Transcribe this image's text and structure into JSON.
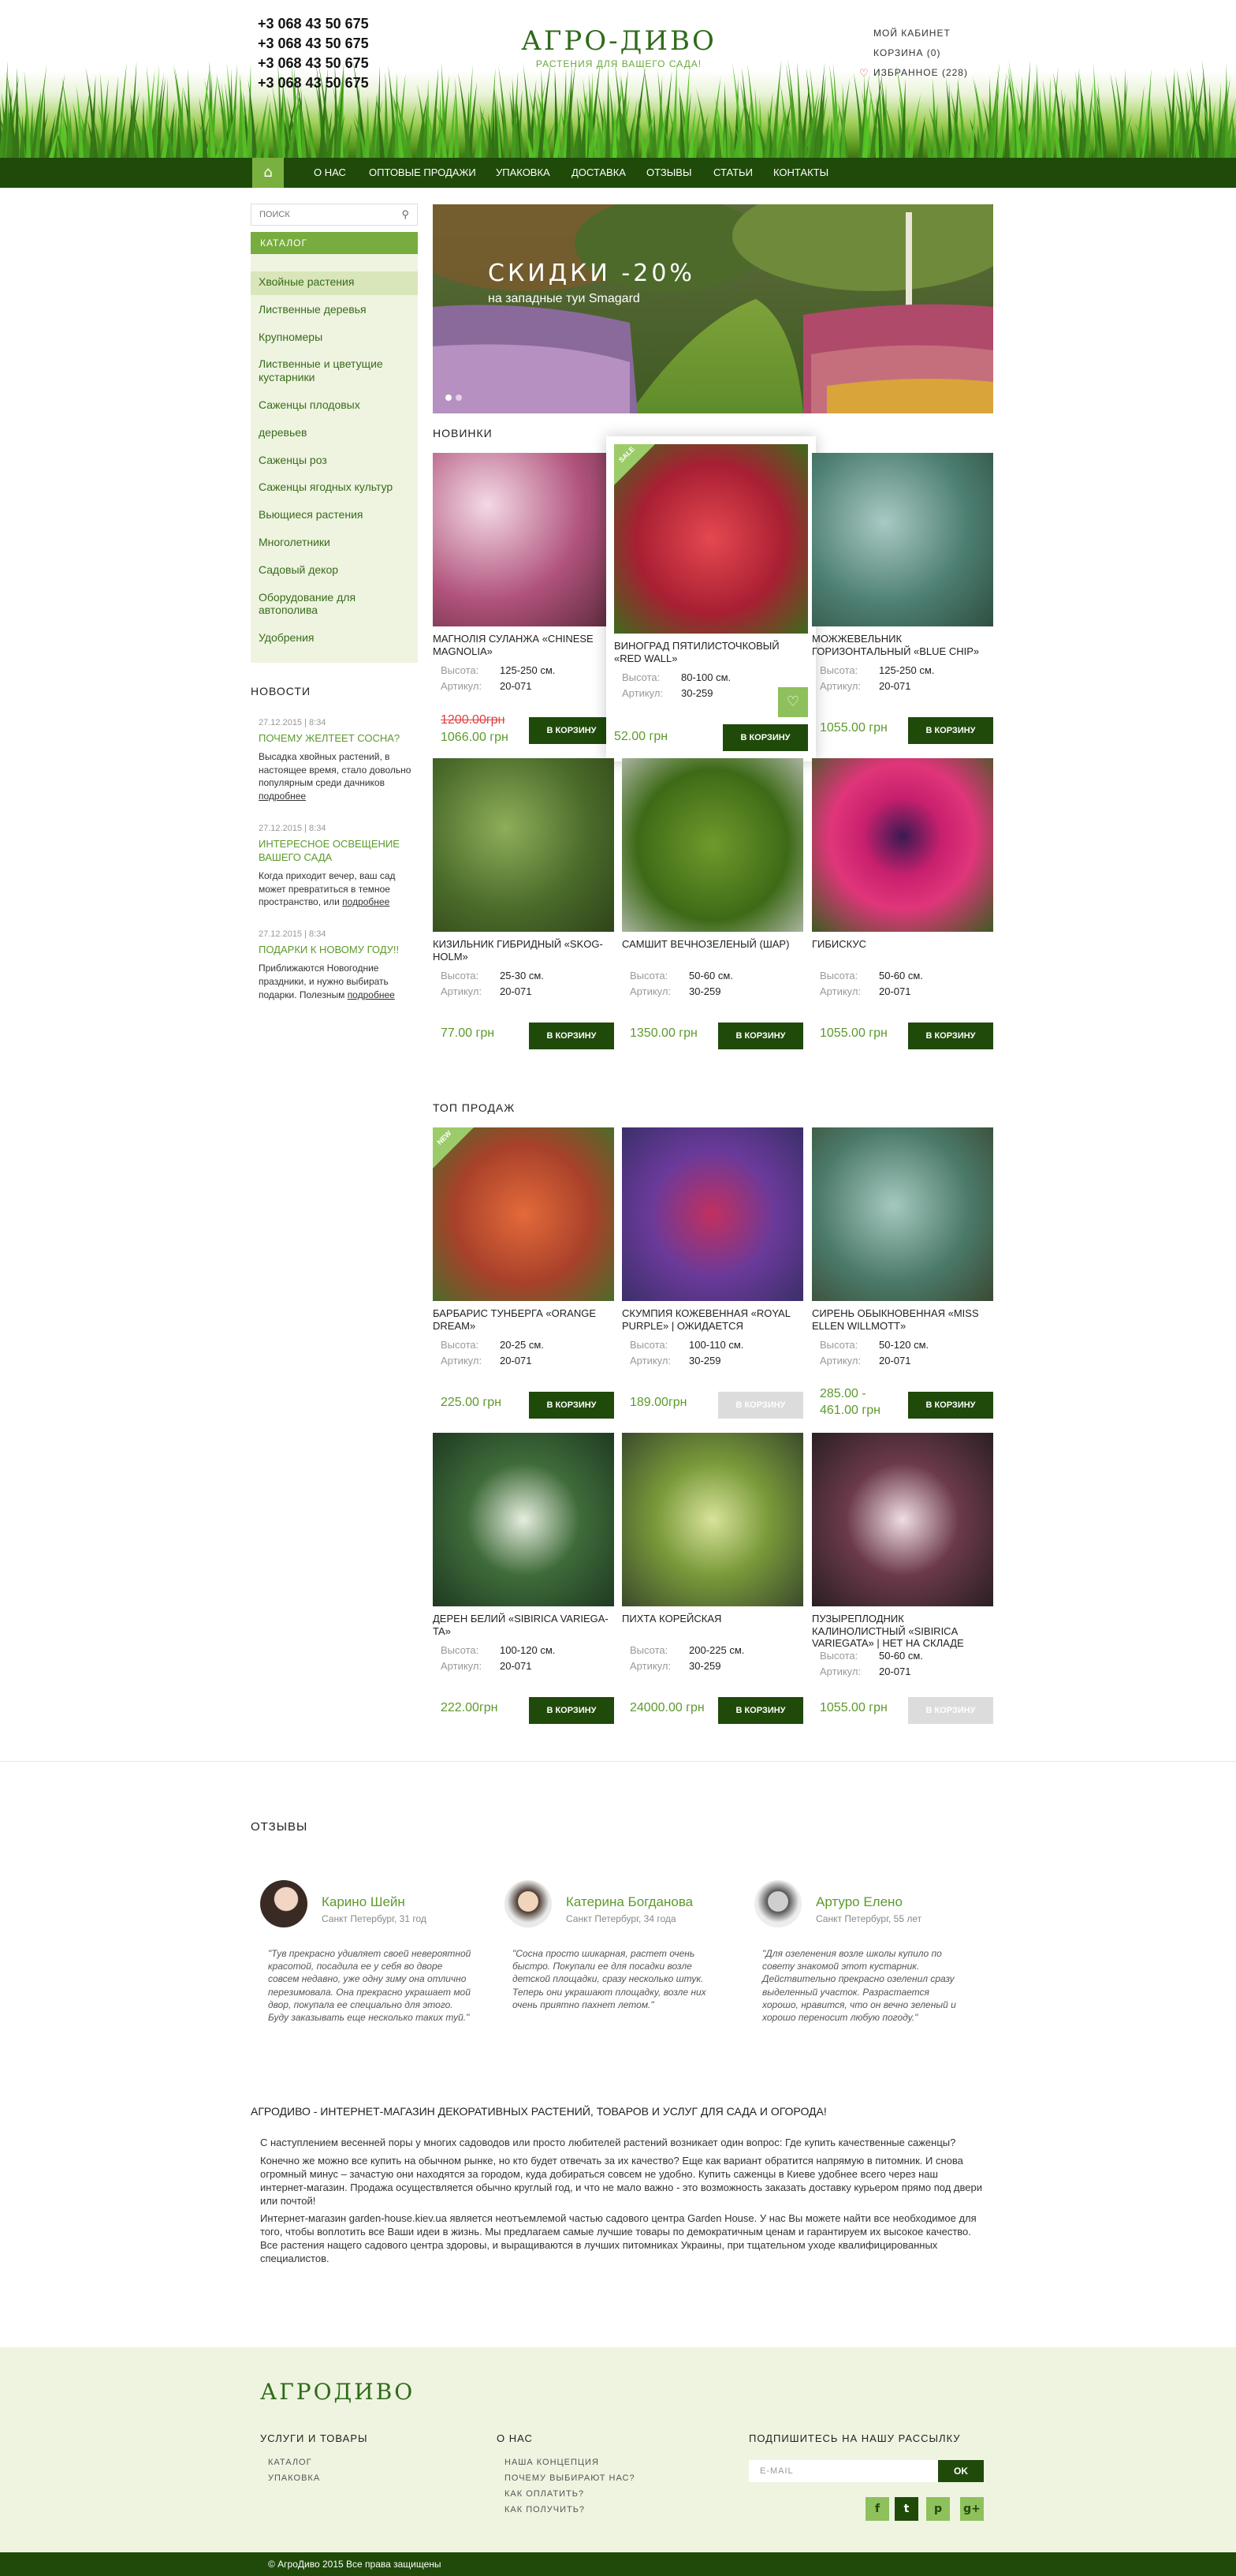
{
  "header": {
    "phones": [
      "+3 068 43 50 675",
      "+3 068 43 50 675",
      "+3 068 43 50 675",
      "+3 068 43 50 675"
    ],
    "logo": {
      "title": "АГРО-ДИВО",
      "subtitle": "РАСТЕНИЯ ДЛЯ ВАШЕГО САДА!"
    },
    "account": {
      "cabinet": "МОЙ КАБИНЕТ",
      "cart": "КОРЗИНА (0)",
      "favorites": "ИЗБРАННОЕ (228)"
    }
  },
  "nav": {
    "items": [
      "О НАС",
      "ОПТОВЫЕ ПРОДАЖИ",
      "УПАКОВКА",
      "ДОСТАВКА",
      "ОТЗЫВЫ",
      "СТАТЬИ",
      "КОНТАКТЫ"
    ]
  },
  "sidebar": {
    "search_placeholder": "ПОИСК",
    "catalog_label": "КАТАЛОГ",
    "categories": [
      "Хвойные растения",
      "Лиственные деревья",
      "Крупномеры",
      "Лиственные и цветущие кустарники",
      "Саженцы плодовых",
      "деревьев",
      "Саженцы роз",
      "Саженцы ягодных культур",
      "Вьющиеся растения",
      "Многолетники",
      "Садовый декор",
      "Оборудование для автополива",
      "Удобрения"
    ],
    "news_title": "НОВОСТИ",
    "news": [
      {
        "date": "27.12.2015 | 8:34",
        "title": "ПОЧЕМУ ЖЕЛТЕЕТ СОСНА?",
        "body": "Высадка хвойных растений, в настоящее время, стало довольно популярным среди дачников",
        "more": "подробнее"
      },
      {
        "date": "27.12.2015 | 8:34",
        "title": "ИНТЕРЕСНОЕ ОСВЕЩЕНИЕ ВАШЕГО САДА",
        "body": "Когда приходит вечер, ваш сад может превратиться в темное пространство, или",
        "more": "подробнее"
      },
      {
        "date": "27.12.2015 | 8:34",
        "title": "ПОДАРКИ К НОВОМУ ГОДУ!!",
        "body": "Приближаются Новогодние праздники, и нужно выбирать подарки. Полезным",
        "more": "подробнее"
      }
    ]
  },
  "banner": {
    "title": "СКИДКИ -20%",
    "subtitle": "на западные туи Smagard"
  },
  "labels": {
    "height": "Высота:",
    "sku": "Артикул:",
    "cart_btn": "В КОРЗИНУ",
    "sale": "SALE",
    "new": "NEW"
  },
  "sections": {
    "new_title": "НОВИНКИ",
    "top_title": "ТОП ПРОДАЖ"
  },
  "products_new": [
    {
      "name": "МАГНОЛІЯ СУЛАНЖА «CHINESE MAGNOLIA»",
      "height": "125-250 см.",
      "sku": "20-071",
      "old_price": "1200.00грн",
      "price": "1066.00 грн"
    },
    {
      "name": "ВИНОГРАД ПЯТИЛИСТОЧКОВЫЙ «RED WALL»",
      "height": "80-100 см.",
      "sku": "30-259",
      "price": "52.00 грн"
    },
    {
      "name": "МОЖЖЕВЕЛЬНИК ГОРИЗОНТАЛЬНЫЙ «BLUE CHIP»",
      "height": "125-250 см.",
      "sku": "20-071",
      "price": "1055.00 грн"
    },
    {
      "name": "КИЗИЛЬНИК ГИБРИДНЫЙ «SKOG-HOLM»",
      "height": "25-30 см.",
      "sku": "20-071",
      "price": "77.00 грн"
    },
    {
      "name": "САМШИТ ВЕЧНОЗЕЛЕНЫЙ (ШАР)",
      "height": "50-60 см.",
      "sku": "30-259",
      "price": "1350.00 грн"
    },
    {
      "name": "ГИБИСКУС",
      "height": "50-60 см.",
      "sku": "20-071",
      "price": "1055.00 грн"
    }
  ],
  "products_top": [
    {
      "name": "БАРБАРИС ТУНБЕРГА «ORANGE DREAM»",
      "height": "20-25 см.",
      "sku": "20-071",
      "price": "225.00 грн"
    },
    {
      "name": "СКУМПИЯ КОЖЕВЕННАЯ «ROYAL PURPLE» | ОЖИДАЕТСЯ",
      "height": "100-110 см.",
      "sku": "30-259",
      "price": "189.00грн"
    },
    {
      "name": "СИРЕНЬ ОБЫКНОВЕННАЯ «MISS ELLEN WILLMOTT»",
      "height": "50-120 см.",
      "sku": "20-071",
      "price": "285.00 - 461.00 грн"
    },
    {
      "name": "ДЕРЕН БЕЛИЙ «SIBIRICA VARIEGA-TA»",
      "height": "100-120 см.",
      "sku": "20-071",
      "price": "222.00грн"
    },
    {
      "name": "ПИХТА КОРЕЙСКАЯ",
      "height": "200-225 см.",
      "sku": "30-259",
      "price": "24000.00 грн"
    },
    {
      "name": "ПУЗЫРЕПЛОДНИК КАЛИНОЛИСТНЫЙ «SIBIRICA VARIEGATA» | НЕТ НА СКЛАДЕ",
      "height": "50-60 см.",
      "sku": "20-071",
      "price": "1055.00 грн"
    }
  ],
  "reviews": {
    "title": "ОТЗЫВЫ",
    "items": [
      {
        "name": "Карино Шейн",
        "city": "Санкт Петербург, 31 год",
        "text": "\"Тув прекрасно удивляет своей невероятной красотой, посадила ее у себя во дворе совсем недавно, уже одну зиму она отлично перезимовала. Она прекрасно украшает мой двор, покупала ее специально для этого. Буду заказывать еще несколько таких туй.\""
      },
      {
        "name": "Катерина Богданова",
        "city": "Санкт Петербург, 34 года",
        "text": "\"Сосна просто шикарная, растет очень быстро. Покупали ее для посадки возле детской площадки, сразу несколько штук. Теперь они украшают площадку, возле них очень приятно пахнет летом.\""
      },
      {
        "name": "Артуро Елено",
        "city": "Санкт Петербург, 55 лет",
        "text": "\"Для озеленения возле школы купило по совету знакомой этот кустарник. Действительно прекрасно озеленил сразу выделенный участок. Разрастается хорошо, нравится, что он вечно зеленый и хорошо переносит любую погоду.\""
      }
    ]
  },
  "about": {
    "title": "АГРОДИВО - ИНТЕРНЕТ-МАГАЗИН ДЕКОРАТИВНЫХ РАСТЕНИЙ, ТОВАРОВ И УСЛУГ ДЛЯ САДА И ОГОРОДА!",
    "p1": "С наступлением весенней поры у многих садоводов или просто любителей растений возникает один вопрос: Где купить качественные саженцы?",
    "p2": "Конечно же можно все купить на обычном рынке, но кто будет отвечать за их качество? Еще как вариант обратится напрямую в питомник. И снова огромный минус – зачастую они находятся за городом, куда добираться совсем не удобно. Купить саженцы в Киеве удобнее всего через наш интернет-магазин. Продажа осуществляется обычно круглый год, и что не мало важно - это возможность заказать доставку курьером прямо под двери или почтой!",
    "p3": "Интернет-магазин garden-house.kiev.ua является неотъемлемой частью садового центра Garden House. У нас Вы можете найти все необходимое для того, чтобы воплотить все Ваши идеи в жизнь. Мы предлагаем самые лучшие товары по демократичным ценам и гарантируем их высокое качество. Все растения нащего садового центра здоровы, и выращиваются в лучших питомниках Украины, при тщательном уходе квалифицированных специалистов."
  },
  "footer": {
    "logo": "АГРОДИВО",
    "col1_title": "УСЛУГИ И ТОВАРЫ",
    "col1_links": [
      "КАТАЛОГ",
      "УПАКОВКА"
    ],
    "col2_title": "О НАС",
    "col2_links": [
      "НАША КОНЦЕПЦИЯ",
      "ПОЧЕМУ ВЫБИРАЮТ НАС?",
      "КАК ОПЛАТИТЬ?",
      "КАК ПОЛУЧИТЬ?"
    ],
    "subscribe_title": "ПОДПИШИТЕСЬ НА НАШУ РАССЫЛКУ",
    "email_placeholder": "E-MAIL",
    "ok": "OK",
    "social": [
      "f",
      "t",
      "p",
      "g+"
    ],
    "copyright": "© АгроДиво 2015 Все права защищены"
  },
  "icons": {
    "home": "home-icon",
    "search": "search-icon",
    "heart": "heart-icon"
  },
  "colors": {
    "brand_dark": "#1f4a0a",
    "brand_green": "#76ad3e",
    "price_green": "#5c9a2c",
    "old_price_red": "#e04040"
  }
}
